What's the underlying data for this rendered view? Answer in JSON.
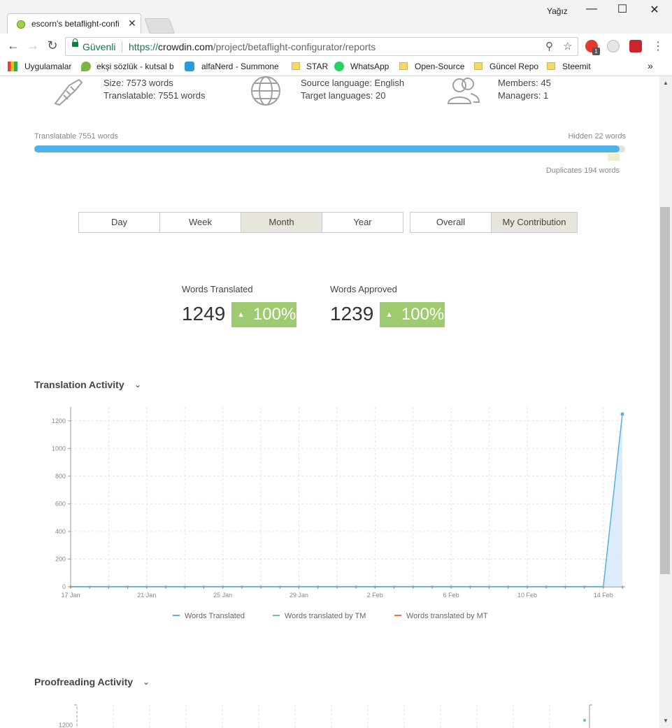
{
  "browser": {
    "tab_title": "escorn's betaflight-configurator",
    "tab_close": "✕",
    "profile": "Yağız",
    "secure_label": "Güvenli",
    "url_scheme": "https://",
    "url_host": "crowdin.com",
    "url_path": "/project/betaflight-configurator/reports",
    "bookmarks": [
      "Uygulamalar",
      "ekşi sözlük - kutsal b",
      "alfaNerd - Summone",
      "STAR",
      "WhatsApp",
      "Open-Source",
      "Güncel Repo",
      "Steemit"
    ],
    "bookmarks_more": "»",
    "opera_badge": "1"
  },
  "stats": {
    "size": "Size: 7573 words",
    "translatable": "Translatable: 7551 words",
    "source_language": "Source language: English",
    "target_languages": "Target languages: 20",
    "members": "Members: 45",
    "managers": "Managers: 1"
  },
  "progress": {
    "translatable_label": "Translatable 7551 words",
    "hidden_label": "Hidden 22 words",
    "duplicates_label": "Duplicates 194 words",
    "fill_fraction": 0.99
  },
  "period_tabs": [
    {
      "label": "Day",
      "active": false
    },
    {
      "label": "Week",
      "active": false
    },
    {
      "label": "Month",
      "active": true
    },
    {
      "label": "Year",
      "active": false
    }
  ],
  "scope_tabs": [
    {
      "label": "Overall",
      "active": false
    },
    {
      "label": "My Contribution",
      "active": true
    }
  ],
  "metrics": {
    "translated_label": "Words Translated",
    "translated_value": "1249",
    "translated_change": "100%",
    "approved_label": "Words Approved",
    "approved_value": "1239",
    "approved_change": "100%"
  },
  "sections": {
    "translation_activity": "Translation Activity",
    "proofreading_activity": "Proofreading Activity"
  },
  "colors": {
    "translated": "#5ab0e0",
    "tm": "#6cc5a0",
    "mt": "#e07a4f",
    "badge": "#9ecb6f"
  },
  "chart_data": [
    {
      "type": "area",
      "title": "Translation Activity",
      "xlabel": "",
      "ylabel": "",
      "ylim": [
        0,
        1300
      ],
      "yticks": [
        0,
        200,
        400,
        600,
        800,
        1000,
        1200
      ],
      "x_tick_labels": [
        "17 Jan",
        "21 Jan",
        "25 Jan",
        "29 Jan",
        "2 Feb",
        "6 Feb",
        "10 Feb",
        "14 Feb"
      ],
      "grid": true,
      "legend": "bottom",
      "x": [
        "17 Jan",
        "18 Jan",
        "19 Jan",
        "20 Jan",
        "21 Jan",
        "22 Jan",
        "23 Jan",
        "24 Jan",
        "25 Jan",
        "26 Jan",
        "27 Jan",
        "28 Jan",
        "29 Jan",
        "30 Jan",
        "31 Jan",
        "1 Feb",
        "2 Feb",
        "3 Feb",
        "4 Feb",
        "5 Feb",
        "6 Feb",
        "7 Feb",
        "8 Feb",
        "9 Feb",
        "10 Feb",
        "11 Feb",
        "12 Feb",
        "13 Feb",
        "14 Feb",
        "15 Feb"
      ],
      "series": [
        {
          "name": "Words Translated",
          "values": [
            0,
            0,
            0,
            0,
            0,
            0,
            0,
            0,
            0,
            0,
            0,
            0,
            0,
            0,
            0,
            0,
            0,
            0,
            0,
            0,
            0,
            0,
            0,
            0,
            0,
            0,
            0,
            0,
            0,
            1249
          ]
        },
        {
          "name": "Words translated by TM",
          "values": [
            0,
            0,
            0,
            0,
            0,
            0,
            0,
            0,
            0,
            0,
            0,
            0,
            0,
            0,
            0,
            0,
            0,
            0,
            0,
            0,
            0,
            0,
            0,
            0,
            0,
            0,
            0,
            0,
            0,
            0
          ]
        },
        {
          "name": "Words translated by MT",
          "values": [
            0,
            0,
            0,
            0,
            0,
            0,
            0,
            0,
            0,
            0,
            0,
            0,
            0,
            0,
            0,
            0,
            0,
            0,
            0,
            0,
            0,
            0,
            0,
            0,
            0,
            0,
            0,
            0,
            0,
            0
          ]
        }
      ]
    },
    {
      "type": "area",
      "title": "Proofreading Activity",
      "yticks": [
        1200
      ]
    }
  ]
}
